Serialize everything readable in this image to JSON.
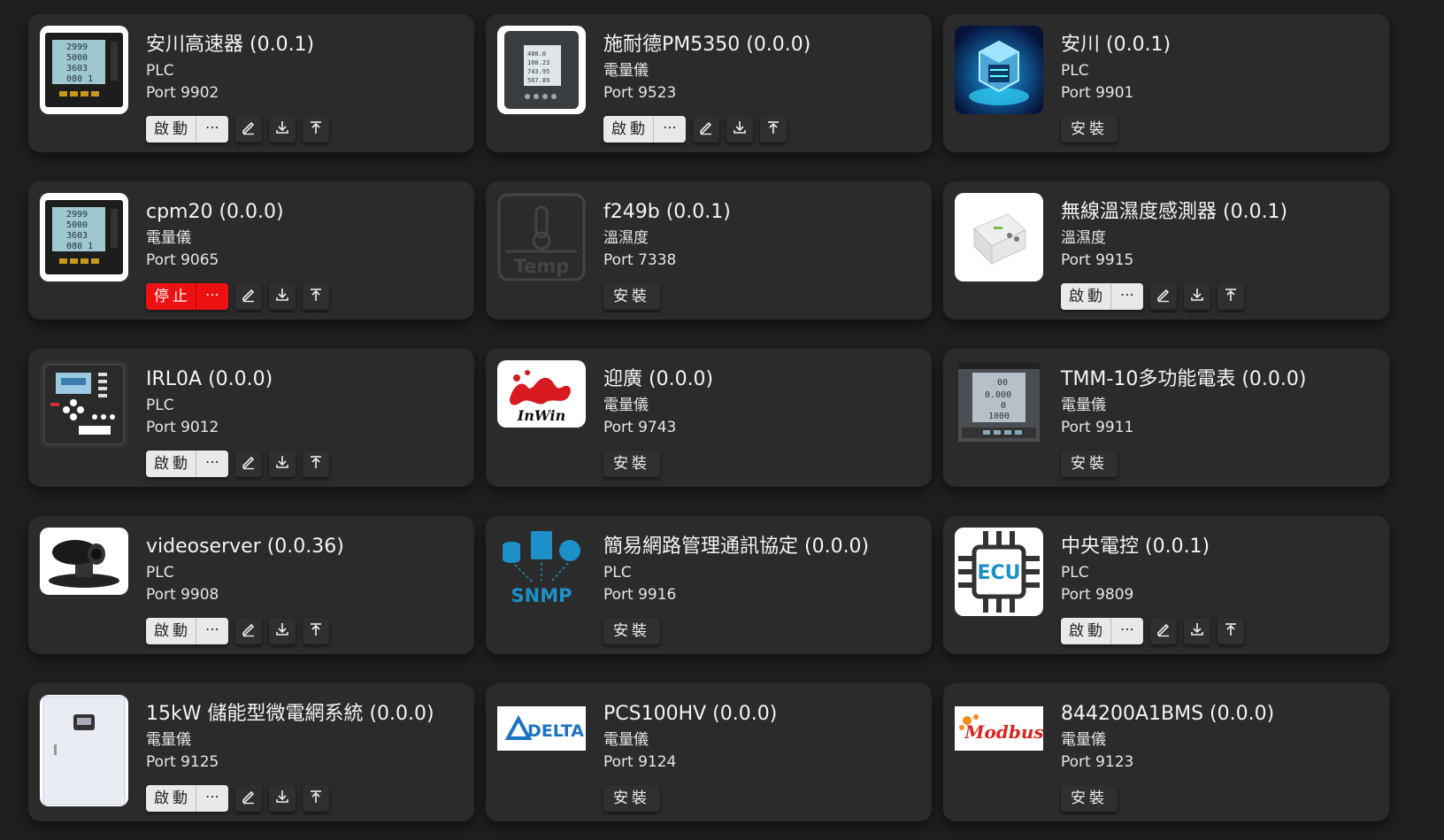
{
  "labels": {
    "start": "啟動",
    "stop": "停止",
    "install": "安裝",
    "more": "⋯"
  },
  "colors": {
    "background": "#1f1f1f",
    "card": "#2b2b2b",
    "stop_button": "#ee1111",
    "start_button": "#e9e9e9"
  },
  "cards": [
    {
      "title": "安川高速器 (0.0.1)",
      "category": "PLC",
      "port": "Port 9902",
      "state": "start",
      "icon": "power-meter-image"
    },
    {
      "title": "施耐德PM5350 (0.0.0)",
      "category": "電量儀",
      "port": "Port 9523",
      "state": "start",
      "icon": "schneider-meter-image"
    },
    {
      "title": "安川 (0.0.1)",
      "category": "PLC",
      "port": "Port 9901",
      "state": "install",
      "icon": "server-cube-image"
    },
    {
      "title": "cpm20 (0.0.0)",
      "category": "電量儀",
      "port": "Port 9065",
      "state": "stop",
      "icon": "power-meter-image"
    },
    {
      "title": "f249b (0.0.1)",
      "category": "溫濕度",
      "port": "Port 7338",
      "state": "install",
      "icon": "temp-placeholder-image"
    },
    {
      "title": "無線溫濕度感測器 (0.0.1)",
      "category": "溫濕度",
      "port": "Port 9915",
      "state": "start",
      "icon": "humidity-sensor-image"
    },
    {
      "title": "IRL0A (0.0.0)",
      "category": "PLC",
      "port": "Port 9012",
      "state": "start",
      "icon": "controller-panel-image"
    },
    {
      "title": "迎廣 (0.0.0)",
      "category": "電量儀",
      "port": "Port 9743",
      "state": "install",
      "icon": "inwin-logo-image"
    },
    {
      "title": "TMM-10多功能電表 (0.0.0)",
      "category": "電量儀",
      "port": "Port 9911",
      "state": "install",
      "icon": "teco-meter-image"
    },
    {
      "title": "videoserver (0.0.36)",
      "category": "PLC",
      "port": "Port 9908",
      "state": "start",
      "icon": "ptz-camera-image"
    },
    {
      "title": "簡易網路管理通訊協定 (0.0.0)",
      "category": "PLC",
      "port": "Port 9916",
      "state": "install",
      "icon": "snmp-logo-image"
    },
    {
      "title": "中央電控 (0.0.1)",
      "category": "PLC",
      "port": "Port 9809",
      "state": "start",
      "icon": "ecu-chip-image"
    },
    {
      "title": "15kW 儲能型微電網系統 (0.0.0)",
      "category": "電量儀",
      "port": "Port 9125",
      "state": "start",
      "icon": "storage-cabinet-image"
    },
    {
      "title": "PCS100HV (0.0.0)",
      "category": "電量儀",
      "port": "Port 9124",
      "state": "install",
      "icon": "delta-logo-image"
    },
    {
      "title": "844200A1BMS (0.0.0)",
      "category": "電量儀",
      "port": "Port 9123",
      "state": "install",
      "icon": "modbus-logo-image"
    }
  ],
  "logo_text": {
    "temp": "Temp",
    "inwin": "InWin",
    "snmp": "SNMP",
    "ecu": "ECU",
    "delta": "DELTA",
    "modbus": "Modbus"
  }
}
